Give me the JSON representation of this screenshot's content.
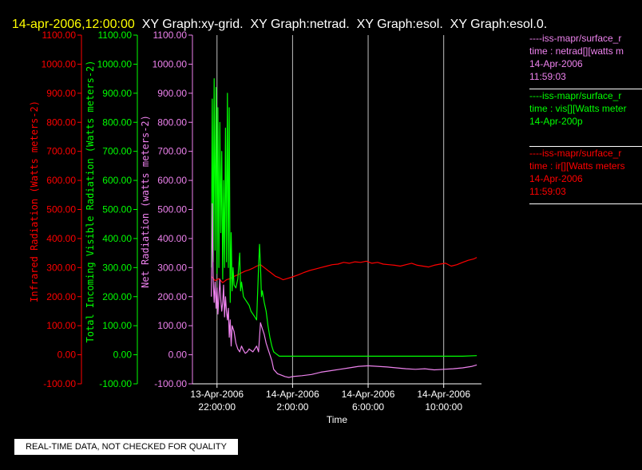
{
  "header": {
    "date_time": "14-apr-2006,12:00:00",
    "graphs_text": "XY Graph:xy-grid.  XY Graph:netrad.  XY Graph:esol.  XY Graph:esol.0."
  },
  "colors": {
    "background": "#000000",
    "header_date": "#ffff00",
    "header_text": "#ffffff",
    "infrared": "#ff0000",
    "visible": "#00ff00",
    "netrad": "#ee82ee",
    "axis": "#ffffff",
    "gridline": "#c0c0c0"
  },
  "legend": [
    {
      "color": "#ee82ee",
      "lines": [
        "----iss-mapr/surface_r",
        "time : netrad[][watts m",
        "14-Apr-2006",
        "11:59:03"
      ]
    },
    {
      "color": "#00ff00",
      "lines": [
        "----iss-mapr/surface_r",
        "time : vis[][Watts meter",
        "14-Apr-200p"
      ]
    },
    {
      "color": "#ff0000",
      "lines": [
        "----iss-mapr/surface_r",
        "time : ir[][Watts meters",
        "14-Apr-2006",
        "11:59:03"
      ]
    }
  ],
  "notice": "REAL-TIME DATA, NOT CHECKED FOR QUALITY",
  "chart_data": {
    "type": "line",
    "xlabel": "Time",
    "x_range_hours": [
      20.7,
      12.0
    ],
    "x_ticks": [
      {
        "hour": 22,
        "label": [
          "13-Apr-2006",
          "22:00:00"
        ]
      },
      {
        "hour": 2,
        "label": [
          "14-Apr-2006",
          "2:00:00"
        ]
      },
      {
        "hour": 6,
        "label": [
          "14-Apr-2006",
          "6:00:00"
        ]
      },
      {
        "hour": 10,
        "label": [
          "14-Apr-2006",
          "10:00:00"
        ]
      }
    ],
    "ylim": [
      -100,
      1100
    ],
    "y_ticks": [
      -100,
      0,
      100,
      200,
      300,
      400,
      500,
      600,
      700,
      800,
      900,
      1000,
      1100
    ],
    "axes": [
      {
        "label": "Infrared Radiation (Watts meters-2)",
        "color": "#ff0000"
      },
      {
        "label": "Total Incoming Visible Radiation (Watts meters-2)",
        "color": "#00ff00"
      },
      {
        "label": "Net Radiation (watts meters-2)",
        "color": "#ee82ee"
      }
    ],
    "grid": "vertical only",
    "series": [
      {
        "name": "ir",
        "color": "#ff0000",
        "points": [
          [
            21.7,
            270
          ],
          [
            21.9,
            255
          ],
          [
            22.1,
            262
          ],
          [
            22.3,
            248
          ],
          [
            22.5,
            258
          ],
          [
            22.7,
            262
          ],
          [
            22.9,
            270
          ],
          [
            23.1,
            275
          ],
          [
            23.3,
            282
          ],
          [
            23.5,
            288
          ],
          [
            23.7,
            292
          ],
          [
            23.9,
            298
          ],
          [
            24.1,
            305
          ],
          [
            24.3,
            310
          ],
          [
            24.5,
            300
          ],
          [
            24.7,
            290
          ],
          [
            24.9,
            280
          ],
          [
            25.1,
            270
          ],
          [
            25.3,
            265
          ],
          [
            25.5,
            258
          ],
          [
            25.7,
            262
          ],
          [
            26.0,
            268
          ],
          [
            26.3,
            275
          ],
          [
            26.6,
            283
          ],
          [
            26.9,
            290
          ],
          [
            27.2,
            295
          ],
          [
            27.5,
            300
          ],
          [
            27.8,
            305
          ],
          [
            28.1,
            310
          ],
          [
            28.4,
            312
          ],
          [
            28.7,
            318
          ],
          [
            29.0,
            315
          ],
          [
            29.3,
            320
          ],
          [
            29.6,
            318
          ],
          [
            29.9,
            322
          ],
          [
            30.2,
            315
          ],
          [
            30.5,
            318
          ],
          [
            30.8,
            312
          ],
          [
            31.1,
            310
          ],
          [
            31.4,
            308
          ],
          [
            31.7,
            305
          ],
          [
            32.0,
            310
          ],
          [
            32.3,
            315
          ],
          [
            32.6,
            308
          ],
          [
            32.9,
            305
          ],
          [
            33.2,
            302
          ],
          [
            33.5,
            308
          ],
          [
            33.8,
            312
          ],
          [
            34.1,
            315
          ],
          [
            34.4,
            305
          ],
          [
            34.7,
            310
          ],
          [
            35.0,
            318
          ],
          [
            35.3,
            325
          ],
          [
            35.6,
            330
          ],
          [
            35.75,
            335
          ]
        ]
      },
      {
        "name": "vis",
        "color": "#00ff00",
        "points": [
          [
            21.7,
            300
          ],
          [
            21.75,
            880
          ],
          [
            21.8,
            320
          ],
          [
            21.85,
            950
          ],
          [
            21.9,
            360
          ],
          [
            21.95,
            920
          ],
          [
            22.0,
            280
          ],
          [
            22.05,
            850
          ],
          [
            22.1,
            300
          ],
          [
            22.15,
            800
          ],
          [
            22.2,
            420
          ],
          [
            22.25,
            700
          ],
          [
            22.3,
            260
          ],
          [
            22.35,
            600
          ],
          [
            22.4,
            300
          ],
          [
            22.45,
            780
          ],
          [
            22.5,
            320
          ],
          [
            22.55,
            900
          ],
          [
            22.6,
            300
          ],
          [
            22.65,
            850
          ],
          [
            22.7,
            180
          ],
          [
            22.75,
            420
          ],
          [
            22.8,
            220
          ],
          [
            22.85,
            300
          ],
          [
            22.9,
            240
          ],
          [
            23.0,
            230
          ],
          [
            23.1,
            260
          ],
          [
            23.2,
            350
          ],
          [
            23.25,
            220
          ],
          [
            23.3,
            250
          ],
          [
            23.4,
            200
          ],
          [
            23.5,
            190
          ],
          [
            23.6,
            180
          ],
          [
            23.7,
            170
          ],
          [
            23.8,
            150
          ],
          [
            23.9,
            140
          ],
          [
            24.0,
            130
          ],
          [
            24.1,
            120
          ],
          [
            24.2,
            300
          ],
          [
            24.25,
            380
          ],
          [
            24.3,
            310
          ],
          [
            24.35,
            200
          ],
          [
            24.4,
            220
          ],
          [
            24.5,
            180
          ],
          [
            24.6,
            150
          ],
          [
            24.7,
            100
          ],
          [
            24.8,
            60
          ],
          [
            24.9,
            30
          ],
          [
            25.0,
            10
          ],
          [
            25.1,
            5
          ],
          [
            25.2,
            0
          ],
          [
            25.3,
            -5
          ],
          [
            25.5,
            -5
          ],
          [
            26.0,
            -5
          ],
          [
            27.0,
            -5
          ],
          [
            28.0,
            -5
          ],
          [
            29.0,
            -5
          ],
          [
            30.0,
            -5
          ],
          [
            31.0,
            -5
          ],
          [
            32.0,
            -5
          ],
          [
            33.0,
            -5
          ],
          [
            34.0,
            -5
          ],
          [
            35.0,
            -5
          ],
          [
            35.75,
            -3
          ]
        ]
      },
      {
        "name": "netrad",
        "color": "#ee82ee",
        "points": [
          [
            21.7,
            200
          ],
          [
            21.75,
            520
          ],
          [
            21.8,
            260
          ],
          [
            21.85,
            180
          ],
          [
            21.9,
            250
          ],
          [
            21.95,
            160
          ],
          [
            22.0,
            230
          ],
          [
            22.05,
            140
          ],
          [
            22.1,
            200
          ],
          [
            22.15,
            260
          ],
          [
            22.2,
            190
          ],
          [
            22.25,
            150
          ],
          [
            22.3,
            180
          ],
          [
            22.35,
            240
          ],
          [
            22.4,
            130
          ],
          [
            22.45,
            200
          ],
          [
            22.5,
            150
          ],
          [
            22.55,
            120
          ],
          [
            22.6,
            160
          ],
          [
            22.65,
            60
          ],
          [
            22.7,
            120
          ],
          [
            22.75,
            30
          ],
          [
            22.8,
            100
          ],
          [
            22.9,
            80
          ],
          [
            23.0,
            40
          ],
          [
            23.1,
            20
          ],
          [
            23.2,
            10
          ],
          [
            23.3,
            30
          ],
          [
            23.4,
            15
          ],
          [
            23.5,
            5
          ],
          [
            23.6,
            10
          ],
          [
            23.7,
            20
          ],
          [
            23.8,
            15
          ],
          [
            23.9,
            10
          ],
          [
            24.0,
            20
          ],
          [
            24.1,
            30
          ],
          [
            24.2,
            10
          ],
          [
            24.3,
            110
          ],
          [
            24.4,
            90
          ],
          [
            24.5,
            70
          ],
          [
            24.6,
            40
          ],
          [
            24.7,
            20
          ],
          [
            24.8,
            0
          ],
          [
            24.9,
            -20
          ],
          [
            25.0,
            -50
          ],
          [
            25.2,
            -65
          ],
          [
            25.4,
            -70
          ],
          [
            25.6,
            -75
          ],
          [
            25.8,
            -78
          ],
          [
            26.0,
            -75
          ],
          [
            26.5,
            -72
          ],
          [
            27.0,
            -68
          ],
          [
            27.5,
            -60
          ],
          [
            28.0,
            -55
          ],
          [
            28.5,
            -50
          ],
          [
            29.0,
            -45
          ],
          [
            29.5,
            -40
          ],
          [
            30.0,
            -38
          ],
          [
            30.5,
            -40
          ],
          [
            31.0,
            -42
          ],
          [
            31.5,
            -45
          ],
          [
            32.0,
            -48
          ],
          [
            32.5,
            -50
          ],
          [
            33.0,
            -48
          ],
          [
            33.5,
            -52
          ],
          [
            34.0,
            -50
          ],
          [
            34.5,
            -48
          ],
          [
            35.0,
            -45
          ],
          [
            35.5,
            -40
          ],
          [
            35.75,
            -35
          ]
        ]
      }
    ]
  }
}
